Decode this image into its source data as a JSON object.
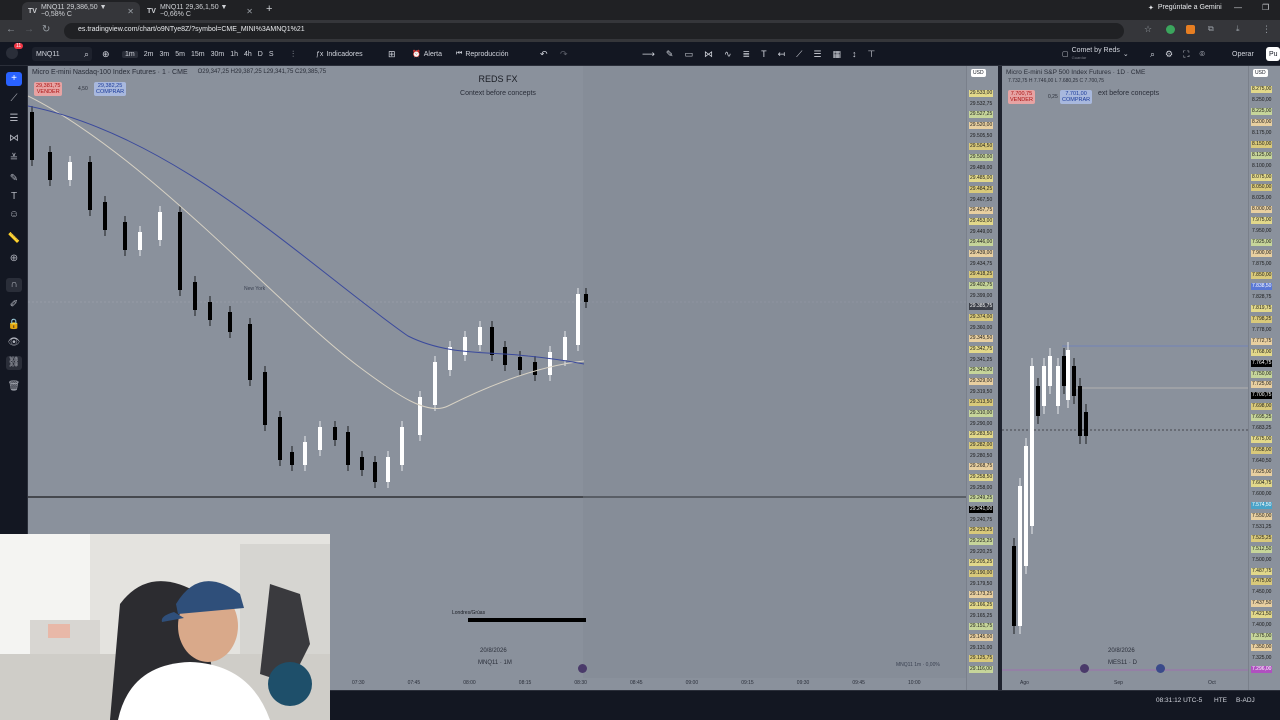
{
  "browser": {
    "tabs": [
      {
        "label": "MNQ11 29,386,50 ▼ −0,58% C",
        "active": true
      },
      {
        "label": "MNQ11 29,36,1,50 ▼ −0,66% C",
        "active": false
      }
    ],
    "url": "es.tradingview.com/chart/o9NTye8Z/?symbol=CME_MINI%3AMNQ1%21",
    "gemini_label": "Pregúntale a Gemini",
    "notification_count": "11"
  },
  "toolbar": {
    "symbol": "MNQ11",
    "intervals": [
      "1m",
      "2m",
      "3m",
      "5m",
      "15m",
      "30m",
      "1h",
      "4h",
      "D",
      "S"
    ],
    "active_interval": "1m",
    "indicators_label": "Indicadores",
    "alert_label": "Alerta",
    "replay_label": "Reproducción",
    "layout_name": "Comet by Reds",
    "layout_sub": "Guardar",
    "trade_label": "Operar",
    "publish_label": "Pu"
  },
  "chart1": {
    "title": "Micro E-mini Nasdaq-100 Index Futures · 1 · CME",
    "ohlc": "O29,347,25 H29,387,25 L29,341,75 C29,385,75",
    "sell_price": "29,381,75",
    "sell_label": "VENDER",
    "spread": "4,50",
    "buy_price": "29,382,25",
    "buy_label": "COMPRAR",
    "watermark_title": "REDS FX",
    "watermark_subtitle": "Context before concepts",
    "session_label": "New York",
    "lower_label": "Londres/Grúas",
    "date_caption": "20/8/2026",
    "symbol_caption": "MNQ11 · 1M",
    "bottom_right_caption": "MNQ11 1m · 0,00%",
    "currency": "USD",
    "time_ticks": [
      "07:30",
      "07:45",
      "08:00",
      "08:15",
      "08:30",
      "08:45",
      "09:00",
      "09:15",
      "09:30",
      "09:45",
      "10:00"
    ],
    "price_labels": [
      "29.533,00",
      "29.532,75",
      "29.527,25",
      "29.520,00",
      "29.505,50",
      "29.504,50",
      "29.500,00",
      "29.489,00",
      "29.485,00",
      "29.484,25",
      "29.467,50",
      "29.457,75",
      "29.453,00",
      "29.449,00",
      "29.446,00",
      "29.439,00",
      "29.434,75",
      "29.418,25",
      "29.402,75",
      "29.399,00",
      "29.385,75",
      "29.374,00",
      "29.360,00",
      "29.345,50",
      "29.342,75",
      "29.341,25",
      "29.341,00",
      "29.329,00",
      "29.319,50",
      "29.313,50",
      "29.310,00",
      "29.290,00",
      "29.283,50",
      "29.282,00",
      "29.280,50",
      "29.268,75",
      "29.258,50",
      "29.258,00",
      "29.249,25",
      "29.241,00",
      "29.240,75",
      "29.233,25",
      "29.225,25",
      "29.220,25",
      "29.205,25",
      "29.190,00",
      "29.179,50",
      "29.173,25",
      "29.166,25",
      "29.165,25",
      "29.151,75",
      "29.145,00",
      "29.131,00",
      "29.125,75",
      "29.116,00"
    ]
  },
  "chart2": {
    "title": "Micro E-mini S&P 500 Index Futures · 1D · CME",
    "ohlc": "7.732,75 H 7.746,00 L 7.680,25 C 7.700,75",
    "sell_price": "7.700,75",
    "sell_label": "VENDER",
    "spread": "0,25",
    "buy_price": "7.701,00",
    "buy_label": "COMPRAR",
    "watermark_subtitle": "ext before concepts",
    "date_caption": "20/8/2026",
    "symbol_caption": "MES11 · D",
    "currency": "USD",
    "time_ticks": [
      "Ago",
      "Sep",
      "Oct"
    ],
    "current_price": "7.700,75",
    "current_time": "07:28:47",
    "price_labels": [
      "8.275,00",
      "8.250,00",
      "8.225,00",
      "8.200,00",
      "8.175,00",
      "8.150,00",
      "8.125,00",
      "8.100,00",
      "8.075,00",
      "8.050,00",
      "8.025,00",
      "8.000,00",
      "7.975,00",
      "7.950,00",
      "7.925,00",
      "7.900,00",
      "7.875,00",
      "7.850,00",
      "7.838,50",
      "7.828,75",
      "7.819,75",
      "7.798,25",
      "7.778,00",
      "7.772,75",
      "7.768,00",
      "7.764,75",
      "7.750,00",
      "7.725,00",
      "7.700,75",
      "7.698,00",
      "7.695,25",
      "7.683,25",
      "7.675,00",
      "7.658,00",
      "7.640,50",
      "7.625,00",
      "7.604,75",
      "7.600,00",
      "7.574,50",
      "7.550,00",
      "7.531,25",
      "7.525,25",
      "7.512,50",
      "7.500,00",
      "7.487,75",
      "7.475,00",
      "7.450,00",
      "7.437,50",
      "7.421,50",
      "7.400,00",
      "7.375,00",
      "7.350,00",
      "7.325,00",
      "7.296,00"
    ]
  },
  "status": {
    "clock": "08:31:12 UTC-5",
    "session": "HTE",
    "adj": "B-ADJ"
  },
  "colors": {
    "chart_bg": "#8a919c",
    "candle_up": "#ffffff",
    "candle_down": "#000000",
    "ma_fast": "#3b4a9c",
    "ma_slow": "#d8d2c4",
    "sell": "#e05555",
    "buy": "#6b8dd6"
  }
}
